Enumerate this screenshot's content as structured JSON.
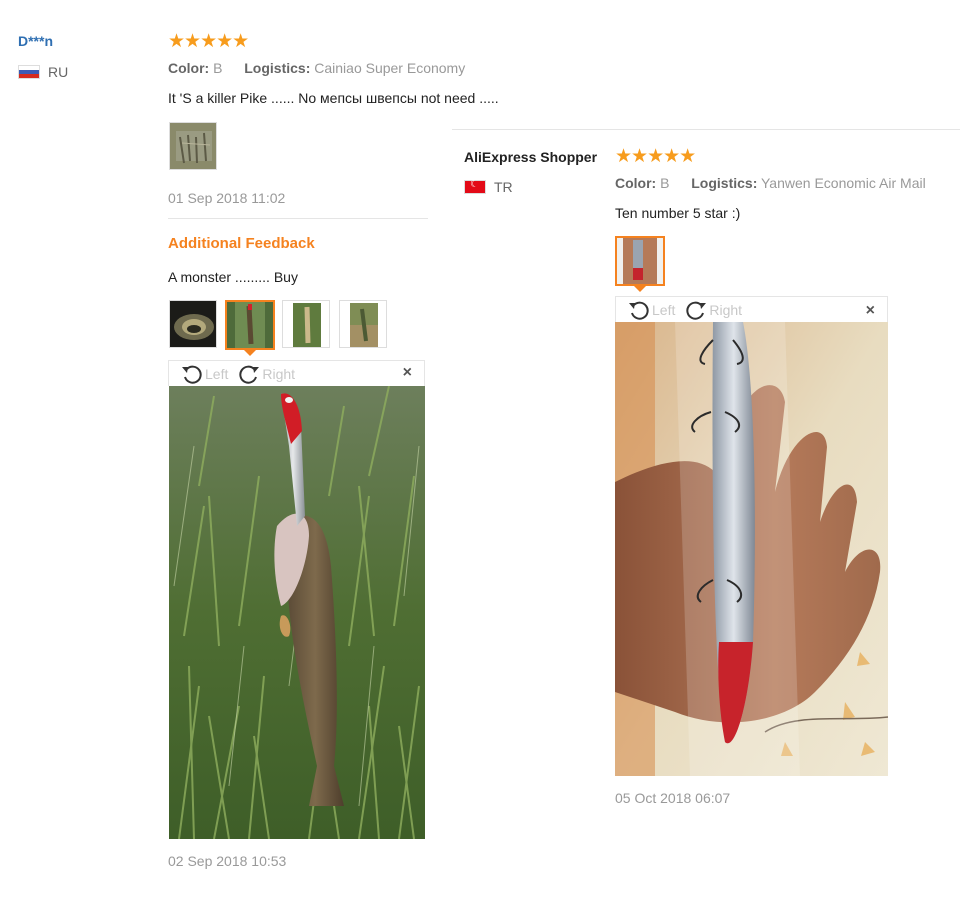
{
  "review1": {
    "user": "D***n",
    "country": "RU",
    "stars": "★★★★★",
    "color_label": "Color:",
    "color_value": "B",
    "logistics_label": "Logistics:",
    "logistics_value": "Cainiao Super Economy",
    "text": "It 'S a killer Pike ...... No мепсы швепсы not need .....",
    "date": "01 Sep 2018 11:02",
    "additional_title": "Additional Feedback",
    "additional_text": "A monster ......... Buy",
    "additional_date": "02 Sep 2018 10:53",
    "viewer": {
      "left": "Left",
      "right": "Right",
      "close": "×"
    }
  },
  "review2": {
    "user": "AliExpress Shopper",
    "country": "TR",
    "stars": "★★★★★",
    "color_label": "Color:",
    "color_value": "B",
    "logistics_label": "Logistics:",
    "logistics_value": "Yanwen Economic Air Mail",
    "text": "Ten number 5 star :)",
    "date": "05 Oct 2018 06:07",
    "viewer": {
      "left": "Left",
      "right": "Right",
      "close": "×"
    }
  },
  "colors": {
    "accent": "#f5821f",
    "star": "#f79c1d",
    "link": "#2f6fb2"
  }
}
